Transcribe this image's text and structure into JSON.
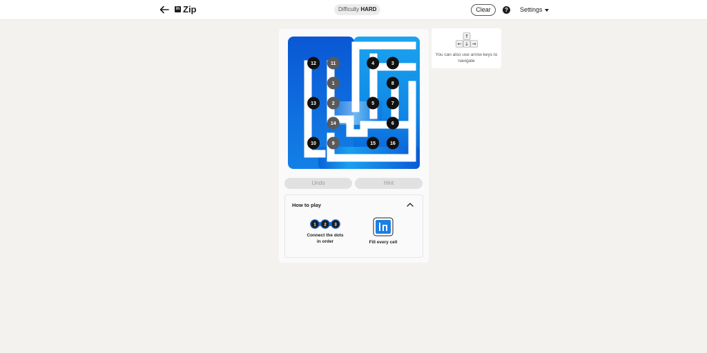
{
  "header": {
    "app_title": "Zip",
    "logo_text": "in",
    "difficulty_label": "Difficulty",
    "difficulty_value": "HARD",
    "clear_label": "Clear",
    "help_label": "?",
    "settings_label": "Settings"
  },
  "game": {
    "grid_size": "6x6",
    "dots": [
      {
        "n": "1",
        "row": 2,
        "col": 2,
        "style": "gray"
      },
      {
        "n": "2",
        "row": 3,
        "col": 2,
        "style": "gray"
      },
      {
        "n": "3",
        "row": 1,
        "col": 5,
        "style": "black"
      },
      {
        "n": "4",
        "row": 1,
        "col": 4,
        "style": "black"
      },
      {
        "n": "5",
        "row": 3,
        "col": 4,
        "style": "black"
      },
      {
        "n": "6",
        "row": 4,
        "col": 5,
        "style": "black"
      },
      {
        "n": "7",
        "row": 3,
        "col": 5,
        "style": "black"
      },
      {
        "n": "8",
        "row": 2,
        "col": 5,
        "style": "black"
      },
      {
        "n": "9",
        "row": 5,
        "col": 2,
        "style": "gray"
      },
      {
        "n": "10",
        "row": 5,
        "col": 1,
        "style": "black"
      },
      {
        "n": "11",
        "row": 1,
        "col": 2,
        "style": "gray"
      },
      {
        "n": "12",
        "row": 1,
        "col": 1,
        "style": "black"
      },
      {
        "n": "13",
        "row": 3,
        "col": 1,
        "style": "black"
      },
      {
        "n": "14",
        "row": 4,
        "col": 2,
        "style": "gray"
      },
      {
        "n": "15",
        "row": 5,
        "col": 4,
        "style": "black"
      },
      {
        "n": "16",
        "row": 5,
        "col": 5,
        "style": "black"
      }
    ],
    "colors": {
      "path_dark": "#0a5ad6",
      "path_light": "#1ea3f0",
      "wall": "#ffffff"
    }
  },
  "controls": {
    "undo_label": "Undo",
    "hint_label": "Hint"
  },
  "how_to_play": {
    "title": "How to play",
    "rule1_dots": [
      "1",
      "2",
      "3"
    ],
    "rule1_text": "Connect the dots in order",
    "rule2_text": "Fill every cell"
  },
  "nav_hint": {
    "text": "You can also use arrow keys to navigate",
    "keys": [
      "↑",
      "←",
      "↓",
      "→"
    ]
  }
}
